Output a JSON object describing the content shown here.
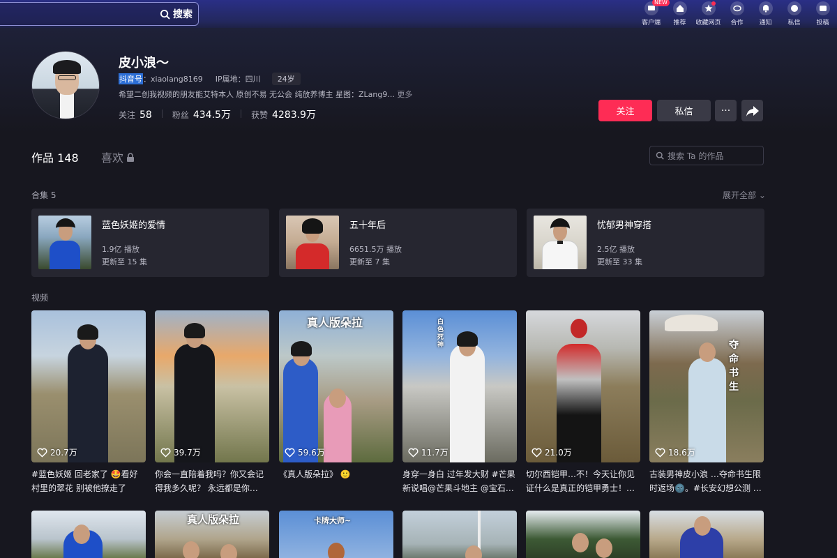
{
  "search": {
    "button_label": "搜索"
  },
  "topnav": [
    {
      "label": "客户端",
      "icon": "client-icon",
      "badge": "NEW"
    },
    {
      "label": "推荐",
      "icon": "home-icon"
    },
    {
      "label": "收藏网页",
      "icon": "star-icon",
      "dot": true
    },
    {
      "label": "合作",
      "icon": "cooperate-icon"
    },
    {
      "label": "通知",
      "icon": "bell-icon"
    },
    {
      "label": "私信",
      "icon": "message-icon"
    },
    {
      "label": "投稿",
      "icon": "upload-icon"
    }
  ],
  "profile": {
    "name": "皮小浪～",
    "douyin_label": "抖音号",
    "douyin_id": "：xiaolang8169",
    "ip": "IP属地：四川",
    "age": "24岁",
    "bio": "希望二创我视频的朋友能艾特本人 原创不易 无公会 纯放养博主 星图：ZLang9...",
    "bio_more": "更多",
    "stats": {
      "following_label": "关注",
      "following": "58",
      "followers_label": "粉丝",
      "followers": "434.5万",
      "likes_label": "获赞",
      "likes": "4283.9万"
    },
    "follow_button": "关注",
    "message_button": "私信",
    "more_button": "···"
  },
  "tabs": {
    "works_label": "作品 148",
    "likes_label": "喜欢"
  },
  "work_search": {
    "placeholder": "搜索 Ta 的作品"
  },
  "collections": {
    "title": "合集 5",
    "expand_label": "展开全部",
    "items": [
      {
        "name": "蓝色妖姬的爱情",
        "plays": "1.9亿 播放",
        "update": "更新至 15 集",
        "color": "#1e4fc8"
      },
      {
        "name": "五十年后",
        "plays": "6651.5万 播放",
        "update": "更新至 7 集",
        "color": "#d42a2a"
      },
      {
        "name": "忧郁男神穿搭",
        "plays": "2.5亿 播放",
        "update": "更新至 33 集",
        "color": "#f2f2f2"
      }
    ]
  },
  "videos": {
    "title": "视频",
    "items": [
      {
        "likes": "20.7万",
        "desc": "#蓝色妖姬 回老家了 🤩看好村里的翠花 别被他撩走了",
        "overlay": ""
      },
      {
        "likes": "39.7万",
        "desc": "你会一直陪着我吗？你又会记得我多久呢？ 永远都是你…",
        "overlay": ""
      },
      {
        "likes": "59.6万",
        "desc": "《真人版朵拉》 🙂",
        "overlay": "真人版朵拉"
      },
      {
        "likes": "11.7万",
        "desc": "身穿一身白 过年发大财 #芒果新说唱@芒果斗地主 @宝石…",
        "overlay": "白色死神"
      },
      {
        "likes": "21.0万",
        "desc": "切尔西铠甲…不！今天让你见证什么是真正的铠甲勇士！…",
        "overlay": ""
      },
      {
        "likes": "18.6万",
        "desc": "古装男神皮小浪 …夺命书生限时返场🌚。#长安幻想公测 …",
        "overlay": "夺命书生"
      }
    ],
    "bottom_overlays": [
      "",
      "真人版朵拉",
      "卡牌大师~",
      "",
      "",
      ""
    ]
  }
}
